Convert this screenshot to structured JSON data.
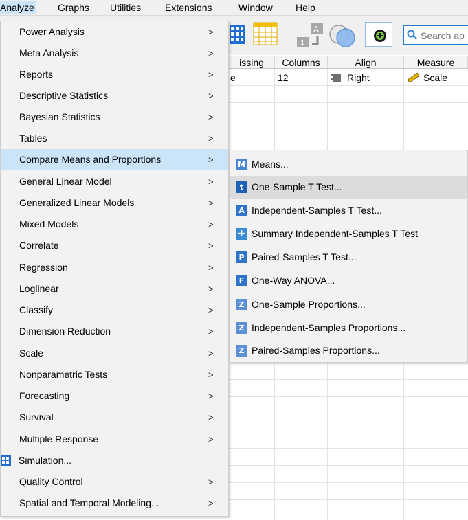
{
  "menubar": {
    "items": [
      "Analyze",
      "Graphs",
      "Utilities",
      "Extensions",
      "Window",
      "Help"
    ]
  },
  "search": {
    "placeholder": "Search ap"
  },
  "grid": {
    "headers": [
      "issing",
      "Columns",
      "Align",
      "Measure"
    ],
    "row1": {
      "missing": "e",
      "columns": "12",
      "align": "Right",
      "measure": "Scale"
    }
  },
  "analyze_menu": {
    "items": [
      {
        "label": "Power Analysis",
        "submenu": true
      },
      {
        "label": "Meta Analysis",
        "submenu": true
      },
      {
        "label": "Reports",
        "submenu": true
      },
      {
        "label": "Descriptive Statistics",
        "submenu": true
      },
      {
        "label": "Bayesian Statistics",
        "submenu": true
      },
      {
        "label": "Tables",
        "submenu": true
      },
      {
        "label": "Compare Means and Proportions",
        "submenu": true
      },
      {
        "label": "General Linear Model",
        "submenu": true
      },
      {
        "label": "Generalized Linear Models",
        "submenu": true
      },
      {
        "label": "Mixed Models",
        "submenu": true
      },
      {
        "label": "Correlate",
        "submenu": true
      },
      {
        "label": "Regression",
        "submenu": true
      },
      {
        "label": "Loglinear",
        "submenu": true
      },
      {
        "label": "Classify",
        "submenu": true
      },
      {
        "label": "Dimension Reduction",
        "submenu": true
      },
      {
        "label": "Scale",
        "submenu": true
      },
      {
        "label": "Nonparametric Tests",
        "submenu": true
      },
      {
        "label": "Forecasting",
        "submenu": true
      },
      {
        "label": "Survival",
        "submenu": true
      },
      {
        "label": "Multiple Response",
        "submenu": true
      },
      {
        "label": "Simulation...",
        "submenu": false
      },
      {
        "label": "Quality Control",
        "submenu": true
      },
      {
        "label": "Spatial and Temporal Modeling...",
        "submenu": true
      }
    ],
    "arrow": ">"
  },
  "submenu": {
    "items": [
      {
        "label": "Means...",
        "icon": "M"
      },
      {
        "label": "One-Sample T Test...",
        "icon": "t"
      },
      {
        "label": "Independent-Samples T Test...",
        "icon": "A"
      },
      {
        "label": "Summary Independent-Samples T Test",
        "icon": "+"
      },
      {
        "label": "Paired-Samples T Test...",
        "icon": "P"
      },
      {
        "label": "One-Way ANOVA...",
        "icon": "F"
      },
      {
        "label": "One-Sample Proportions...",
        "icon": "Z"
      },
      {
        "label": "Independent-Samples Proportions...",
        "icon": "Z"
      },
      {
        "label": "Paired-Samples Proportions...",
        "icon": "Z"
      }
    ]
  },
  "colors": {
    "menu_hover": "#cce4f7",
    "submenu_hover": "#dcdcdc",
    "accent": "#2a7bd4"
  }
}
